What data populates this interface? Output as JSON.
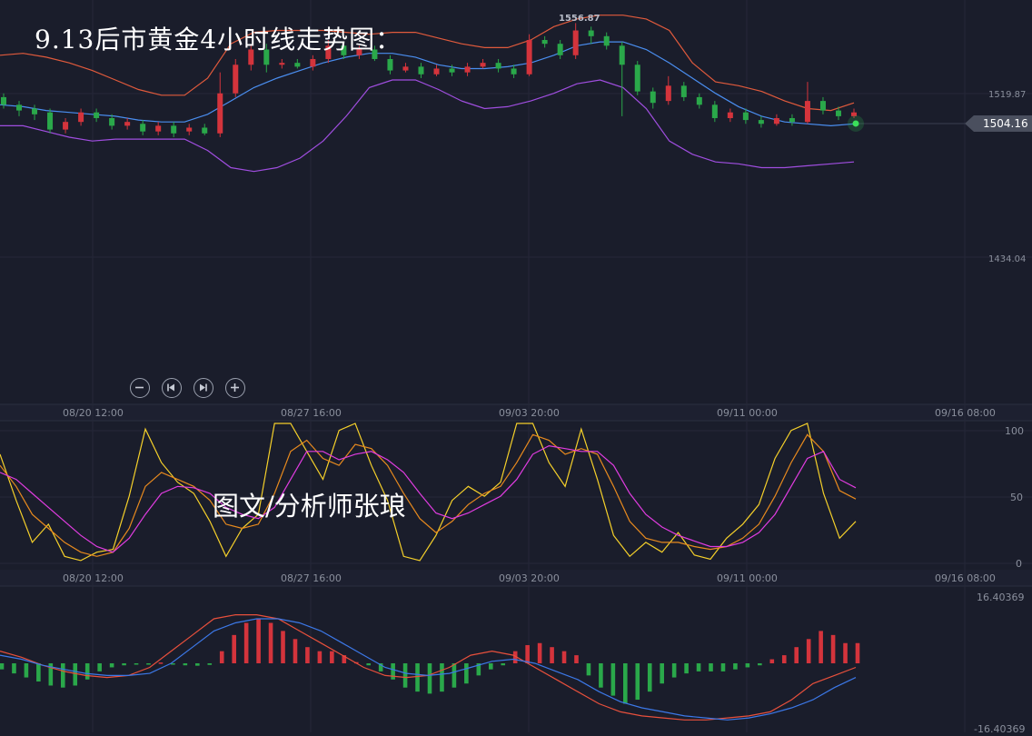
{
  "title": "9.13后市黄金4小时线走势图：",
  "watermark": "图文/分析师张琅",
  "price_axis": {
    "upper": "1519.87",
    "lower": "1434.04",
    "current": "1504.16",
    "peak": "1556.87"
  },
  "time_labels": [
    "08/20 12:00",
    "08/27 16:00",
    "09/03 20:00",
    "09/11 00:00",
    "09/16 08:00"
  ],
  "kdj_axis": [
    "100",
    "50",
    "0"
  ],
  "macd_axis": {
    "top": "16.40369",
    "bottom": "-16.40369"
  },
  "controls": {
    "zoom_out": "zoom-out",
    "prev": "step-back",
    "next": "step-forward",
    "zoom_in": "zoom-in"
  },
  "colors": {
    "up": "#d4343c",
    "down": "#2aa84a",
    "upper_band": "#e05a3c",
    "mid_band": "#4a8ef0",
    "lower_band": "#a04ee0",
    "k_line": "#f5d02a",
    "d_line": "#e88a1e",
    "j_line": "#e03ce0",
    "dif": "#e8503c",
    "dea": "#3c78e8"
  },
  "chart_data": [
    {
      "type": "candlestick",
      "panel": "price",
      "ylim": [
        1420,
        1560
      ],
      "ticks": [
        "1519.87",
        "1434.04"
      ],
      "bollinger": {
        "upper": [
          1540,
          1541,
          1539,
          1536,
          1532,
          1527,
          1522,
          1519,
          1519,
          1528,
          1546,
          1552,
          1553,
          1553,
          1553,
          1552,
          1551,
          1552,
          1552,
          1549,
          1546,
          1544,
          1544,
          1548,
          1555,
          1559,
          1561,
          1561,
          1559,
          1553,
          1536,
          1526,
          1524,
          1521,
          1516,
          1512,
          1511,
          1515
        ],
        "mid": [
          1514,
          1513,
          1511,
          1510,
          1509,
          1508,
          1506,
          1505,
          1505,
          1509,
          1516,
          1523,
          1528,
          1532,
          1536,
          1539,
          1541,
          1541,
          1539,
          1535,
          1533,
          1533,
          1534,
          1536,
          1540,
          1545,
          1547,
          1547,
          1543,
          1536,
          1528,
          1520,
          1513,
          1508,
          1505,
          1504,
          1503,
          1504
        ],
        "lower": [
          1503,
          1503,
          1500,
          1497,
          1495,
          1496,
          1496,
          1496,
          1496,
          1490,
          1481,
          1479,
          1481,
          1486,
          1495,
          1508,
          1523,
          1527,
          1527,
          1522,
          1516,
          1512,
          1513,
          1516,
          1520,
          1525,
          1527,
          1523,
          1512,
          1495,
          1488,
          1484,
          1483,
          1481,
          1481,
          1482,
          1483,
          1484
        ]
      },
      "candles": [
        [
          1518,
          1514,
          1520,
          1512
        ],
        [
          1514,
          1511,
          1516,
          1508
        ],
        [
          1512,
          1509,
          1514,
          1506
        ],
        [
          1510,
          1501,
          1512,
          1499
        ],
        [
          1501,
          1505,
          1507,
          1499
        ],
        [
          1505,
          1510,
          1512,
          1503
        ],
        [
          1510,
          1507,
          1512,
          1505
        ],
        [
          1507,
          1503,
          1509,
          1501
        ],
        [
          1503,
          1505,
          1507,
          1501
        ],
        [
          1504,
          1500,
          1506,
          1498
        ],
        [
          1500,
          1503,
          1505,
          1498
        ],
        [
          1503,
          1499,
          1505,
          1497
        ],
        [
          1500,
          1502,
          1504,
          1498
        ],
        [
          1502,
          1499,
          1504,
          1498
        ],
        [
          1499,
          1520,
          1531,
          1497
        ],
        [
          1520,
          1535,
          1538,
          1518
        ],
        [
          1535,
          1543,
          1545,
          1532
        ],
        [
          1543,
          1535,
          1546,
          1531
        ],
        [
          1535,
          1536,
          1538,
          1533
        ],
        [
          1536,
          1534,
          1538,
          1533
        ],
        [
          1534,
          1538,
          1540,
          1532
        ],
        [
          1538,
          1545,
          1548,
          1536
        ],
        [
          1545,
          1540,
          1547,
          1538
        ],
        [
          1540,
          1543,
          1545,
          1538
        ],
        [
          1543,
          1538,
          1545,
          1537
        ],
        [
          1538,
          1532,
          1540,
          1530
        ],
        [
          1532,
          1534,
          1536,
          1531
        ],
        [
          1534,
          1530,
          1536,
          1528
        ],
        [
          1530,
          1533,
          1535,
          1529
        ],
        [
          1533,
          1531,
          1535,
          1529
        ],
        [
          1531,
          1534,
          1536,
          1529
        ],
        [
          1534,
          1536,
          1538,
          1533
        ],
        [
          1536,
          1533,
          1538,
          1531
        ],
        [
          1533,
          1530,
          1535,
          1528
        ],
        [
          1530,
          1548,
          1551,
          1529
        ],
        [
          1548,
          1546,
          1550,
          1544
        ],
        [
          1546,
          1540,
          1548,
          1538
        ],
        [
          1540,
          1553,
          1556.87,
          1538
        ],
        [
          1553,
          1550,
          1555,
          1546
        ],
        [
          1550,
          1545,
          1552,
          1543
        ],
        [
          1545,
          1535,
          1547,
          1508
        ],
        [
          1535,
          1521,
          1537,
          1519
        ],
        [
          1521,
          1515,
          1523,
          1512
        ],
        [
          1516,
          1524,
          1529,
          1514
        ],
        [
          1524,
          1518,
          1526,
          1516
        ],
        [
          1518,
          1514,
          1520,
          1512
        ],
        [
          1514,
          1507,
          1516,
          1505
        ],
        [
          1507,
          1510,
          1512,
          1505
        ],
        [
          1510,
          1506,
          1512,
          1504
        ],
        [
          1506,
          1504,
          1508,
          1502
        ],
        [
          1504,
          1507,
          1509,
          1503
        ],
        [
          1507,
          1505,
          1509,
          1503
        ],
        [
          1505,
          1516,
          1526,
          1504
        ],
        [
          1516,
          1511,
          1518,
          1509
        ],
        [
          1511,
          1508,
          1513,
          1506
        ],
        [
          1508,
          1510,
          1512,
          1507
        ]
      ]
    },
    {
      "type": "line",
      "panel": "kdj",
      "ylim": [
        0,
        100
      ],
      "series": [
        {
          "values": [
            78,
            45,
            15,
            28,
            5,
            2,
            8,
            10,
            48,
            96,
            72,
            58,
            50,
            30,
            5,
            25,
            35,
            100,
            100,
            80,
            60,
            95,
            100,
            70,
            45,
            5,
            2,
            20,
            45,
            55,
            48,
            58,
            100,
            100,
            72,
            55,
            96,
            60,
            20,
            5,
            15,
            8,
            22,
            6,
            3,
            18,
            28,
            42,
            75,
            95,
            100,
            50,
            18,
            30
          ]
        },
        {
          "values": [
            70,
            55,
            35,
            25,
            15,
            8,
            5,
            8,
            25,
            55,
            65,
            60,
            55,
            45,
            28,
            25,
            28,
            50,
            80,
            88,
            75,
            70,
            85,
            82,
            70,
            50,
            32,
            22,
            30,
            42,
            50,
            55,
            72,
            92,
            88,
            78,
            82,
            78,
            55,
            30,
            18,
            15,
            15,
            12,
            10,
            12,
            18,
            28,
            48,
            72,
            92,
            80,
            52,
            46
          ]
        },
        {
          "values": [
            65,
            60,
            50,
            40,
            30,
            20,
            12,
            8,
            18,
            35,
            50,
            55,
            54,
            50,
            40,
            35,
            32,
            40,
            60,
            80,
            80,
            74,
            78,
            80,
            74,
            65,
            50,
            36,
            32,
            36,
            42,
            48,
            60,
            78,
            84,
            82,
            80,
            80,
            70,
            50,
            35,
            26,
            20,
            16,
            12,
            12,
            15,
            22,
            35,
            55,
            75,
            80,
            60,
            54
          ]
        }
      ]
    },
    {
      "type": "bar",
      "panel": "macd",
      "ylim": [
        -16.40369,
        16.40369
      ],
      "histogram": [
        -1.5,
        -2.5,
        -3.5,
        -4.5,
        -5.5,
        -6,
        -5.5,
        -4,
        -2,
        -1,
        -0.5,
        -0.3,
        -0.2,
        0.2,
        -0.3,
        -0.5,
        -0.6,
        -0.4,
        3,
        7,
        10,
        11,
        10,
        8,
        6,
        4,
        3,
        3,
        2,
        0.3,
        -0.5,
        -2,
        -4,
        -6,
        -7,
        -7.5,
        -7,
        -6,
        -5,
        -3,
        -1.5,
        -0.5,
        3,
        4.5,
        5,
        4,
        3,
        2,
        -3,
        -6,
        -8,
        -10,
        -9,
        -7,
        -5,
        -3.5,
        -2.5,
        -2,
        -2,
        -2,
        -1.5,
        -1,
        -0.5,
        1,
        2,
        4,
        6,
        8,
        7,
        5,
        5
      ],
      "dif": [
        3,
        1.5,
        -0.5,
        -2,
        -3,
        -3.5,
        -3,
        -1,
        3,
        7,
        11,
        12,
        12,
        11,
        8,
        5,
        2,
        -1,
        -3,
        -3.5,
        -3,
        -1,
        2,
        3,
        2,
        -1,
        -4,
        -7,
        -10,
        -12,
        -13,
        -13.5,
        -14,
        -14,
        -13.5,
        -13,
        -12,
        -9,
        -5,
        -3,
        -1
      ],
      "dea": [
        2,
        1,
        -0.5,
        -1.5,
        -2.5,
        -3,
        -3,
        -2.5,
        0,
        4,
        8,
        10,
        11,
        11,
        10,
        8,
        5,
        2,
        -1,
        -2.5,
        -3,
        -2.5,
        -1,
        0.5,
        1,
        0,
        -2,
        -4,
        -7,
        -9.5,
        -11,
        -12,
        -13,
        -13.5,
        -14,
        -13.5,
        -12.5,
        -11,
        -9,
        -6,
        -3.5
      ]
    }
  ]
}
